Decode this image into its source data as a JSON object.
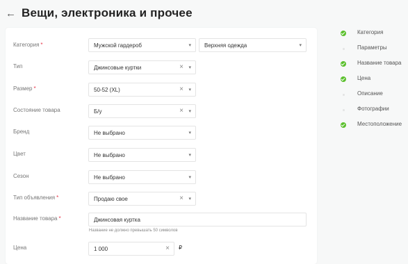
{
  "header": {
    "back_icon": "←",
    "title": "Вещи, электроника и прочее"
  },
  "colors": {
    "required": "#e8364a",
    "done": "#5cc02e",
    "todo": "#e3e3e3"
  },
  "form": {
    "category": {
      "label": "Категория",
      "value": "Мужской гардероб",
      "sub_value": "Верхняя одежда"
    },
    "type": {
      "label": "Тип",
      "value": "Джинсовые куртки"
    },
    "size": {
      "label": "Размер",
      "value": "50-52 (XL)"
    },
    "condition": {
      "label": "Состояние товара",
      "value": "Б/у"
    },
    "brand": {
      "label": "Бренд",
      "value": "Не выбрано"
    },
    "color": {
      "label": "Цвет",
      "value": "Не выбрано"
    },
    "season": {
      "label": "Сезон",
      "value": "Не выбрано"
    },
    "ad_type": {
      "label": "Тип объявления",
      "value": "Продаю свое"
    },
    "name": {
      "label": "Название товара",
      "value": "Джинсовая куртка",
      "hint": "Название не должно превышать 50 символов"
    },
    "price": {
      "label": "Цена",
      "value": "1 000",
      "currency": "₽"
    },
    "required_mark": "*",
    "chevron": "▾",
    "clear": "×"
  },
  "steps": [
    {
      "label": "Категория",
      "done": true
    },
    {
      "label": "Параметры",
      "done": false
    },
    {
      "label": "Название товара",
      "done": true
    },
    {
      "label": "Цена",
      "done": true
    },
    {
      "label": "Описание",
      "done": false
    },
    {
      "label": "Фотографии",
      "done": false
    },
    {
      "label": "Местоположение",
      "done": true
    }
  ]
}
